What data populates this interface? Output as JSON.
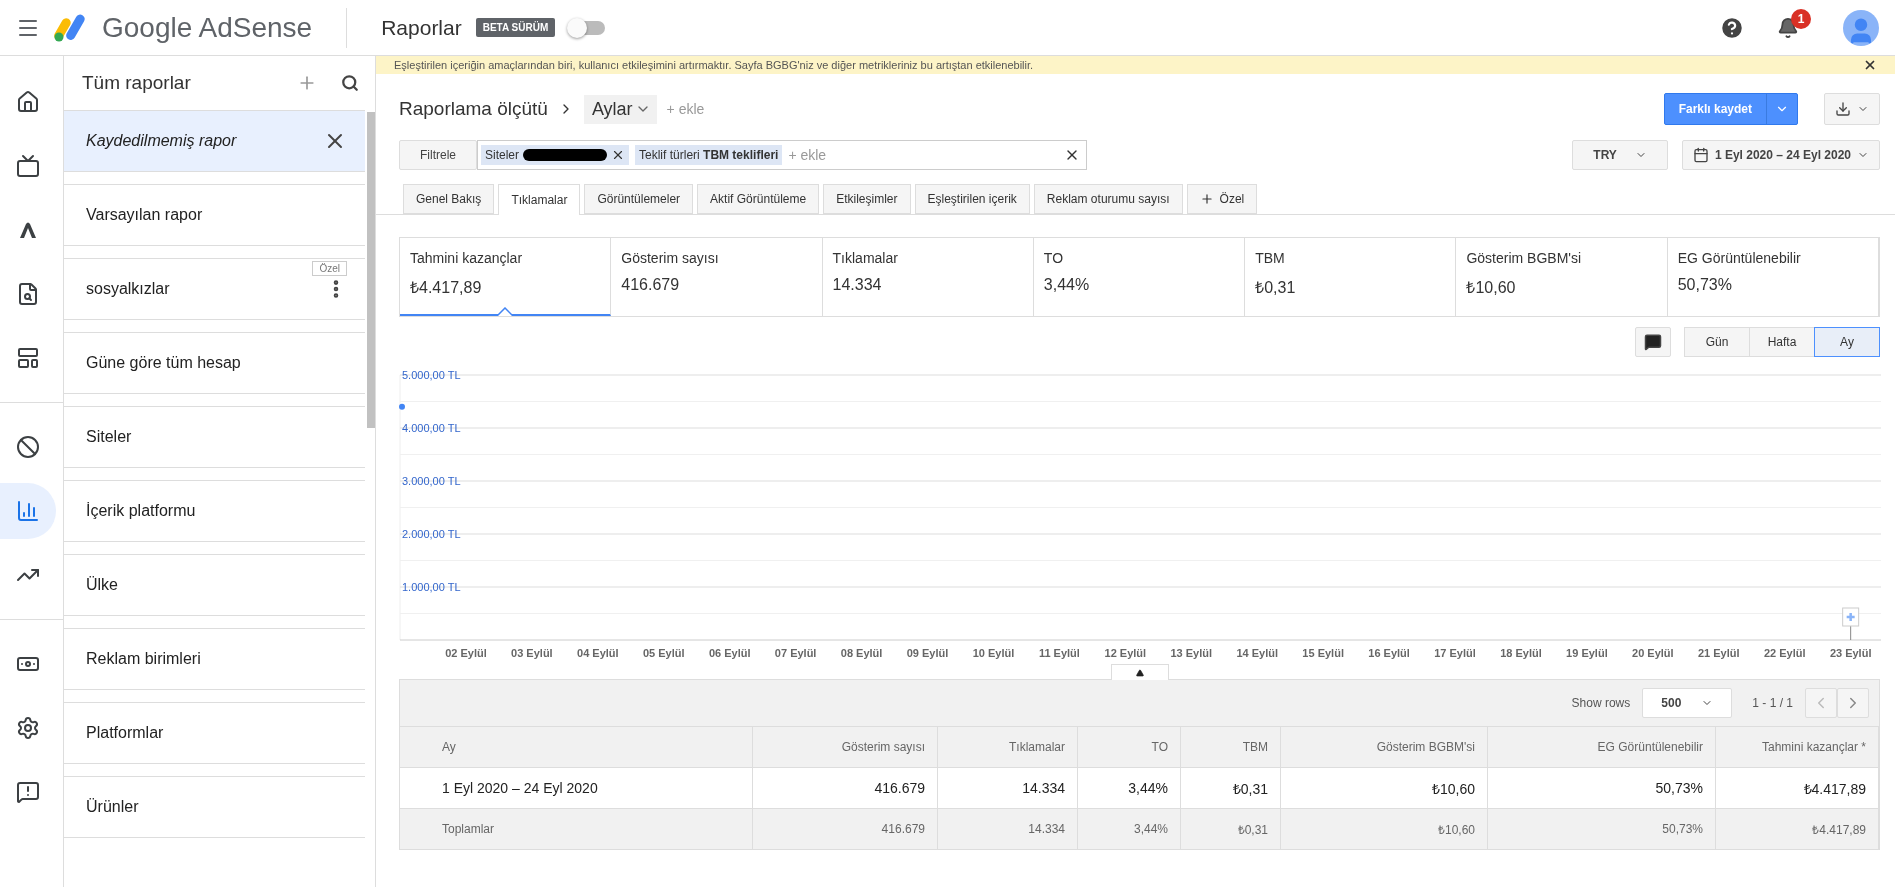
{
  "topbar": {
    "product": "Google AdSense",
    "page_title": "Raporlar",
    "beta_badge": "BETA SÜRÜM",
    "beta_toggle": {
      "on": false
    },
    "notification_count": "1"
  },
  "nav_rail": [
    {
      "kind": "home",
      "selected": false
    },
    {
      "kind": "display",
      "selected": false
    },
    {
      "kind": "ads",
      "selected": false
    },
    {
      "kind": "review",
      "selected": false
    },
    {
      "kind": "layout",
      "selected": false
    },
    {
      "kind": "block",
      "selected": false
    },
    {
      "kind": "reports",
      "selected": true
    },
    {
      "kind": "trend",
      "selected": false
    },
    {
      "kind": "payments",
      "selected": false
    },
    {
      "kind": "settings",
      "selected": false
    },
    {
      "kind": "feedback",
      "selected": false
    }
  ],
  "sidebar": {
    "title": "Tüm raporlar",
    "items": [
      {
        "label": "Kaydedilmemiş rapor",
        "selected": true
      },
      {
        "label": "Varsayılan rapor",
        "selected": false
      },
      {
        "label": "sosyalkızlar",
        "selected": false,
        "badge": "Özel"
      },
      {
        "label": "Güne göre tüm hesap",
        "selected": false
      },
      {
        "label": "Siteler",
        "selected": false
      },
      {
        "label": "İçerik platformu",
        "selected": false
      },
      {
        "label": "Ülke",
        "selected": false
      },
      {
        "label": "Reklam birimleri",
        "selected": false
      },
      {
        "label": "Platformlar",
        "selected": false
      },
      {
        "label": "Ürünler",
        "selected": false
      }
    ]
  },
  "banner": {
    "text": "Eşleştirilen içeriğin amaçlarından biri, kullanıcı etkileşimini artırmaktır. Sayfa BGBG'niz ve diğer metrikleriniz bu artıştan etkilenebilir."
  },
  "report": {
    "label": "Raporlama ölçütü",
    "dimension": "Aylar",
    "add": "+ ekle",
    "save_button": "Farklı kaydet"
  },
  "filter": {
    "button": "Filtrele",
    "chips": [
      {
        "label": "Siteler",
        "redacted": true
      },
      {
        "label": "Teklif türleri **TBM teklifleri**",
        "redacted": false
      }
    ],
    "add": "+ ekle"
  },
  "currency": "TRY",
  "date_range": "1 Eyl 2020 – 24 Eyl 2020",
  "tabs": [
    {
      "kind": "tab",
      "label": "Genel Bakış",
      "selected": false
    },
    {
      "kind": "tab",
      "label": "Tıklamalar",
      "selected": true
    },
    {
      "kind": "tab",
      "label": "Görüntülemeler",
      "selected": false
    },
    {
      "kind": "tab",
      "label": "Aktif Görüntüleme",
      "selected": false
    },
    {
      "kind": "tab",
      "label": "Etkileşimler",
      "selected": false
    },
    {
      "kind": "tab",
      "label": "Eşleştirilen içerik",
      "selected": false
    },
    {
      "kind": "tab",
      "label": "Reklam oturumu sayısı",
      "selected": false
    },
    {
      "kind": "add",
      "label": "Özel",
      "selected": false
    }
  ],
  "metrics": [
    {
      "label": "Tahmini kazançlar",
      "value": "₺4.417,89",
      "selected": true
    },
    {
      "label": "Gösterim sayısı",
      "value": "416.679",
      "selected": false
    },
    {
      "label": "Tıklamalar",
      "value": "14.334",
      "selected": false
    },
    {
      "label": "TO",
      "value": "3,44%",
      "selected": false
    },
    {
      "label": "TBM",
      "value": "₺0,31",
      "selected": false
    },
    {
      "label": "Gösterim BGBM'si",
      "value": "₺10,60",
      "selected": false
    },
    {
      "label": "EG Görüntülenebilir",
      "value": "50,73%",
      "selected": false
    }
  ],
  "granularity": [
    {
      "label": "Gün",
      "selected": false
    },
    {
      "label": "Hafta",
      "selected": false
    },
    {
      "label": "Ay",
      "selected": true
    }
  ],
  "chart_data": {
    "type": "line",
    "grid": true,
    "x": [
      1
    ],
    "xlim": [
      1,
      23.46
    ],
    "ylim": [
      0,
      5000
    ],
    "yticks": [
      {
        "value": 1000,
        "label": "1.000,00 TL"
      },
      {
        "value": 2000,
        "label": "2.000,00 TL"
      },
      {
        "value": 3000,
        "label": "3.000,00 TL"
      },
      {
        "value": 4000,
        "label": "4.000,00 TL"
      },
      {
        "value": 5000,
        "label": "5.000,00 TL"
      }
    ],
    "xticks": [
      {
        "value": 2,
        "label": "02 Eylül"
      },
      {
        "value": 3,
        "label": "03 Eylül"
      },
      {
        "value": 4,
        "label": "04 Eylül"
      },
      {
        "value": 5,
        "label": "05 Eylül"
      },
      {
        "value": 6,
        "label": "06 Eylül"
      },
      {
        "value": 7,
        "label": "07 Eylül"
      },
      {
        "value": 8,
        "label": "08 Eylül"
      },
      {
        "value": 9,
        "label": "09 Eylül"
      },
      {
        "value": 10,
        "label": "10 Eylül"
      },
      {
        "value": 11,
        "label": "11 Eylül"
      },
      {
        "value": 12,
        "label": "12 Eylül"
      },
      {
        "value": 13,
        "label": "13 Eylül"
      },
      {
        "value": 14,
        "label": "14 Eylül"
      },
      {
        "value": 15,
        "label": "15 Eylül"
      },
      {
        "value": 16,
        "label": "16 Eylül"
      },
      {
        "value": 17,
        "label": "17 Eylül"
      },
      {
        "value": 18,
        "label": "18 Eylül"
      },
      {
        "value": 19,
        "label": "19 Eylül"
      },
      {
        "value": 20,
        "label": "20 Eylül"
      },
      {
        "value": 21,
        "label": "21 Eylül"
      },
      {
        "value": 22,
        "label": "22 Eylül"
      },
      {
        "value": 23,
        "label": "23 Eylül"
      }
    ],
    "series": [
      {
        "color": "#4285f4",
        "marker": true,
        "values": [
          4400
        ]
      }
    ]
  },
  "table": {
    "show_rows_label": "Show rows",
    "rows_per_page": "500",
    "page_info": "1 - 1 / 1",
    "columns": [
      "Ay",
      "Gösterim sayısı",
      "Tıklamalar",
      "TO",
      "TBM",
      "Gösterim BGBM'si",
      "EG Görüntülenebilir",
      "Tahmini kazançlar *"
    ],
    "rows": [
      [
        "1 Eyl 2020 – 24 Eyl 2020",
        "416.679",
        "14.334",
        "3,44%",
        "₺0,31",
        "₺10,60",
        "50,73%",
        "₺4.417,89"
      ]
    ],
    "totals": [
      "Toplamlar",
      "416.679",
      "14.334",
      "3,44%",
      "₺0,31",
      "₺10,60",
      "50,73%",
      "₺4.417,89"
    ]
  }
}
